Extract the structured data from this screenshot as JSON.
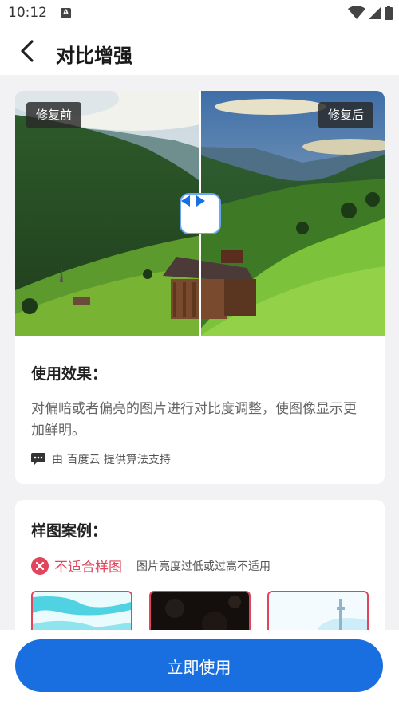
{
  "status": {
    "time": "10:12",
    "notif_letter": "A"
  },
  "header": {
    "title": "对比增强"
  },
  "compare": {
    "before_label": "修复前",
    "after_label": "修复后"
  },
  "effect": {
    "title": "使用效果：",
    "description": "对偏暗或者偏亮的图片进行对比度调整，使图像显示更加鲜明。",
    "provider": "由 百度云 提供算法支持"
  },
  "samples": {
    "title": "样图案例：",
    "unsuitable_label": "不适合样图",
    "unsuitable_note": "图片亮度过低或过高不适用"
  },
  "action": {
    "primary_label": "立即使用"
  },
  "colors": {
    "accent": "#1a6fe0",
    "error": "#e0455c",
    "background": "#f2f2f4"
  }
}
